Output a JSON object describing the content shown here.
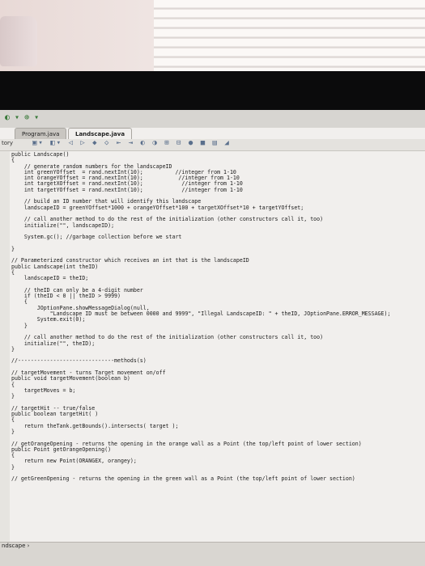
{
  "window": {
    "tabs": [
      {
        "label": "Program.java"
      },
      {
        "label": "Landscape.java"
      }
    ],
    "toolbar_label": "tory",
    "status_label": "ndscape ›"
  },
  "code_lines": [
    "public Landscape()",
    "{",
    "    // generate random numbers for the landscapeID",
    "    int greenYOffset  = rand.nextInt(10);          //integer from 1-10",
    "    int orangeYOffset = rand.nextInt(10);           //integer from 1-10",
    "    int targetXOffset = rand.nextInt(10);            //integer from 1-10",
    "    int targetYOffset = rand.nextInt(10);            //integer from 1-10",
    "",
    "    // build an ID number that will identify this landscape",
    "    landscapeID = greenYOffset*1000 + orangeYOffset*100 + targetXOffset*10 + targetYOffset;",
    "",
    "    // call another method to do the rest of the initialization (other constructors call it, too)",
    "    initialize(\"\", landscapeID);",
    "",
    "    System.gc(); //garbage collection before we start",
    "",
    "}",
    "",
    "// Parameterized constructor which receives an int that is the landscapeID",
    "public Landscape(int theID)",
    "{",
    "    landscapeID = theID;",
    "",
    "    // theID can only be a 4-digit number",
    "    if (theID < 0 || theID > 9999)",
    "    {",
    "        JOptionPane.showMessageDialog(null,",
    "            \"Landscape ID must be between 0000 and 9999\", \"Illegal LandscapeID: \" + theID, JOptionPane.ERROR_MESSAGE);",
    "        System.exit(0);",
    "    }",
    "",
    "    // call another method to do the rest of the initialization (other constructors call it, too)",
    "    initialize(\"\", theID);",
    "}",
    "",
    "//------------------------------methods(s)",
    "",
    "// targetMovement - turns Target movement on/off",
    "public void targetMovement(boolean b)",
    "{",
    "    targetMoves = b;",
    "}",
    "",
    "// targetHit -- true/false",
    "public boolean targetHit( )",
    "{",
    "    return theTank.getBounds().intersects( target );",
    "}",
    "",
    "// getOrangeOpening - returns the opening in the orange wall as a Point (the top/left point of lower section)",
    "public Point getOrangeOpening()",
    "{",
    "    return new Point(ORANGEX, orangey);",
    "}",
    "",
    "// getGreenOpening - returns the opening in the green wall as a Point (the top/left point of lower section)"
  ]
}
